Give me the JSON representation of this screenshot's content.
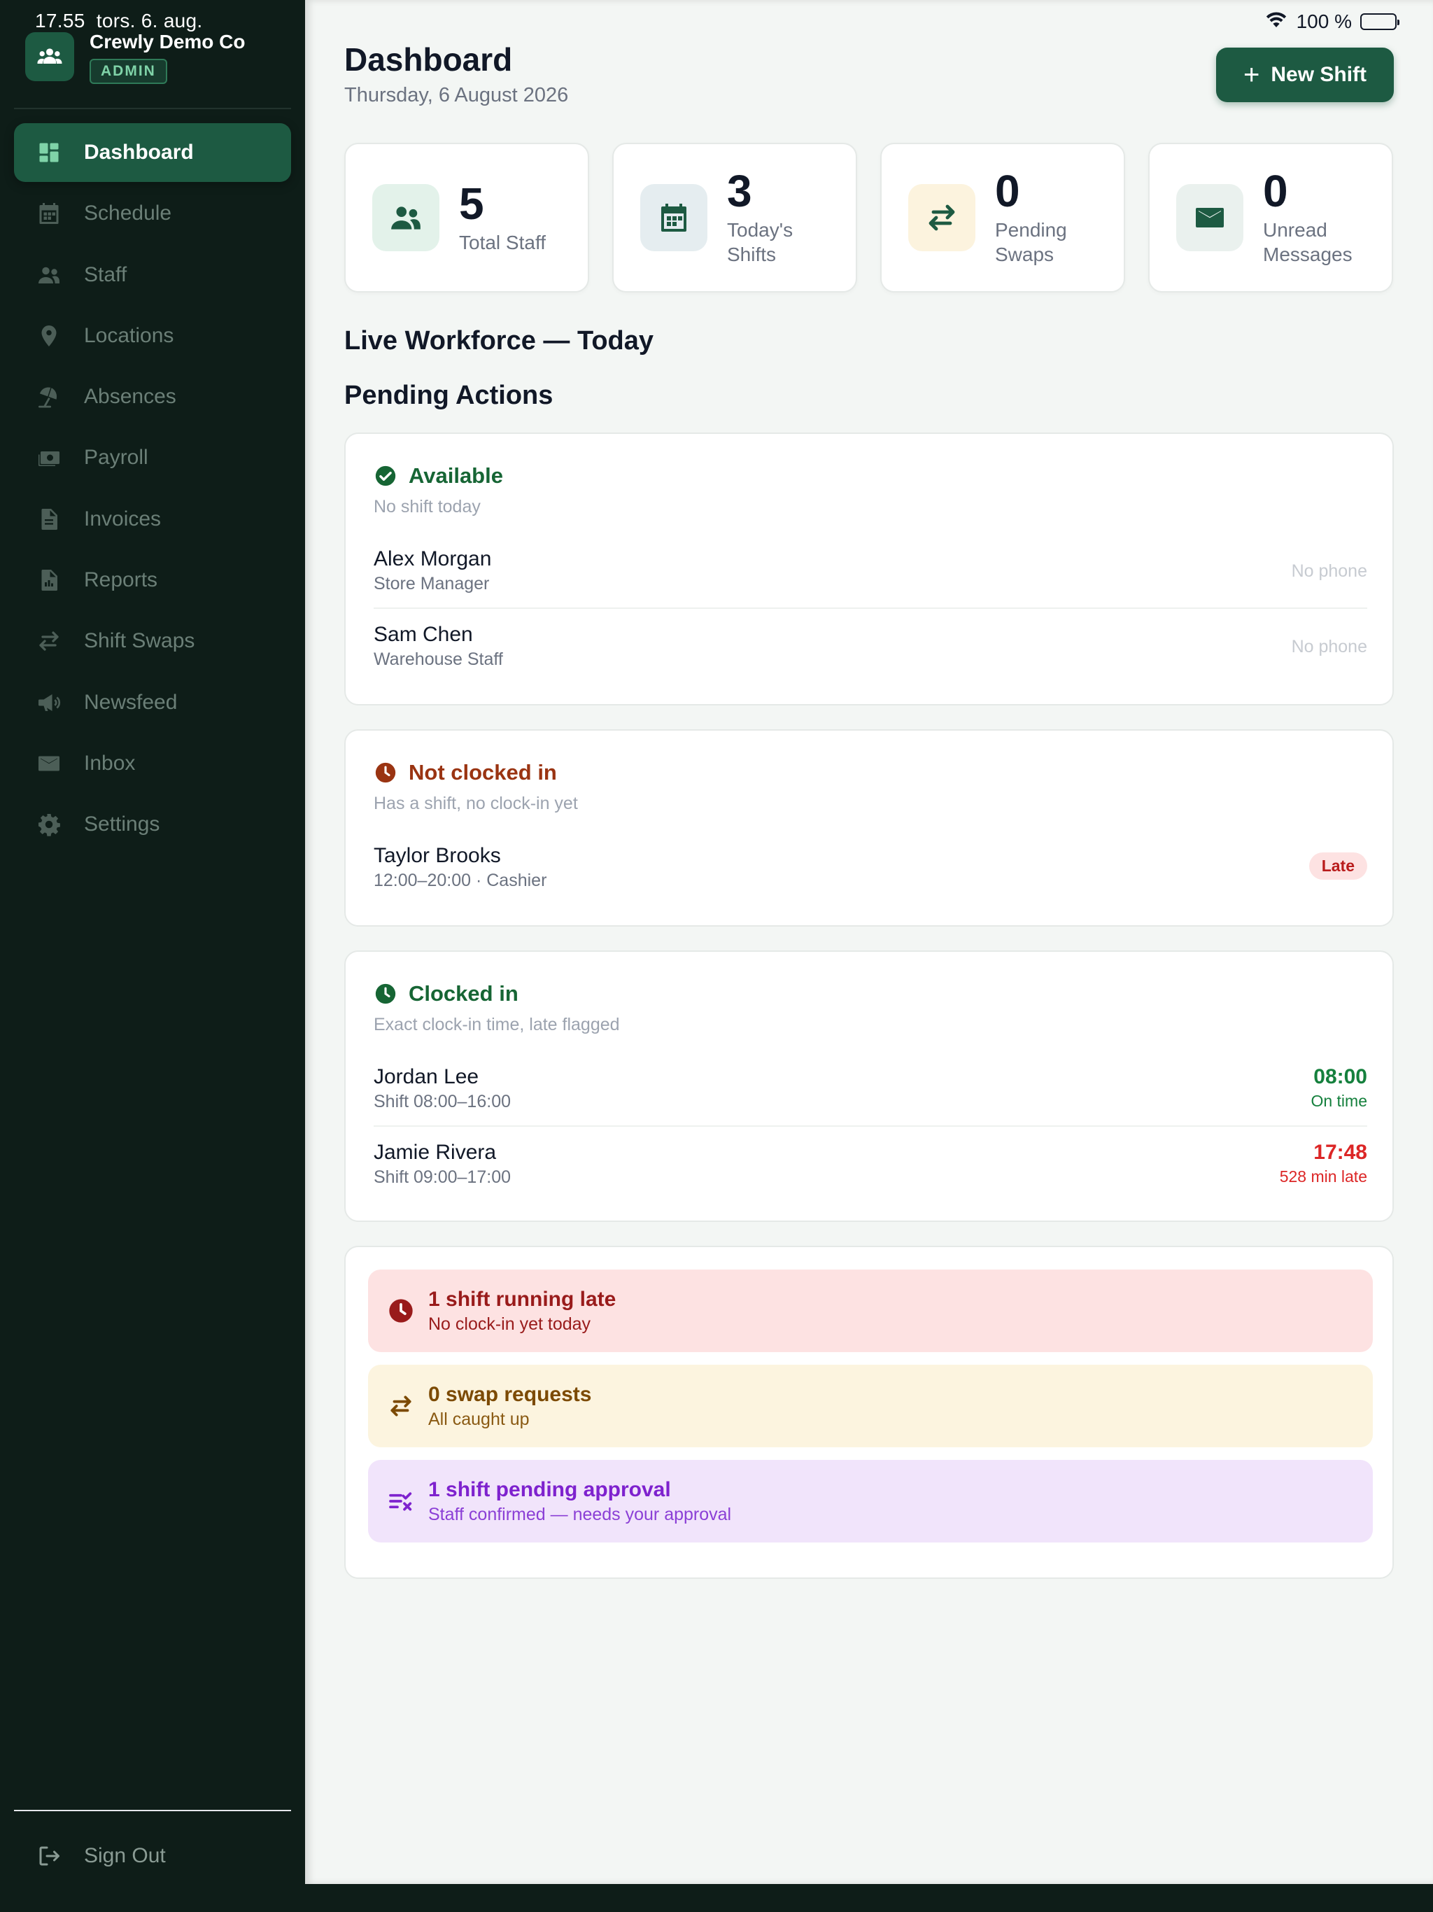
{
  "status_bar": {
    "time": "17.55",
    "date": "tors. 6. aug.",
    "battery": "100 %"
  },
  "brand": {
    "name": "Crewly Demo Co",
    "role": "ADMIN"
  },
  "nav": {
    "items": [
      {
        "label": "Dashboard",
        "icon": "dashboard-icon"
      },
      {
        "label": "Schedule",
        "icon": "calendar-icon"
      },
      {
        "label": "Staff",
        "icon": "people-icon"
      },
      {
        "label": "Locations",
        "icon": "location-pin-icon"
      },
      {
        "label": "Absences",
        "icon": "beach-umbrella-icon"
      },
      {
        "label": "Payroll",
        "icon": "money-icon"
      },
      {
        "label": "Invoices",
        "icon": "document-icon"
      },
      {
        "label": "Reports",
        "icon": "report-icon"
      },
      {
        "label": "Shift Swaps",
        "icon": "swap-icon"
      },
      {
        "label": "Newsfeed",
        "icon": "megaphone-icon"
      },
      {
        "label": "Inbox",
        "icon": "mail-icon"
      },
      {
        "label": "Settings",
        "icon": "gear-icon"
      }
    ],
    "active": "Dashboard",
    "sign_out": "Sign Out"
  },
  "header": {
    "title": "Dashboard",
    "date": "Thursday, 6 August 2026",
    "new_shift": "New Shift"
  },
  "stats": [
    {
      "value": "5",
      "label": "Total Staff",
      "icon": "people-icon"
    },
    {
      "value": "3",
      "label": "Today's Shifts",
      "icon": "calendar-icon"
    },
    {
      "value": "0",
      "label": "Pending Swaps",
      "icon": "swap-icon"
    },
    {
      "value": "0",
      "label": "Unread Messages",
      "icon": "mail-icon"
    }
  ],
  "sections": {
    "live_workforce": "Live Workforce — Today",
    "pending_actions": "Pending Actions"
  },
  "available": {
    "title": "Available",
    "subtitle": "No shift today",
    "rows": [
      {
        "name": "Alex Morgan",
        "role": "Store Manager",
        "phone": "No phone"
      },
      {
        "name": "Sam Chen",
        "role": "Warehouse Staff",
        "phone": "No phone"
      }
    ]
  },
  "not_clocked_in": {
    "title": "Not clocked in",
    "subtitle": "Has a shift, no clock-in yet",
    "rows": [
      {
        "name": "Taylor Brooks",
        "meta": "12:00–20:00 · Cashier",
        "badge": "Late"
      }
    ]
  },
  "clocked_in": {
    "title": "Clocked in",
    "subtitle": "Exact clock-in time, late flagged",
    "rows": [
      {
        "name": "Jordan Lee",
        "shift": "Shift 08:00–16:00",
        "time": "08:00",
        "status": "On time"
      },
      {
        "name": "Jamie Rivera",
        "shift": "Shift 09:00–17:00",
        "time": "17:48",
        "status": "528 min late"
      }
    ]
  },
  "alerts": [
    {
      "title": "1 shift running late",
      "subtitle": "No clock-in yet today",
      "icon": "clock-icon"
    },
    {
      "title": "0 swap requests",
      "subtitle": "All caught up",
      "icon": "swap-icon"
    },
    {
      "title": "1 shift pending approval",
      "subtitle": "Staff confirmed — needs your approval",
      "icon": "checklist-icon"
    }
  ],
  "colors": {
    "sidebar_bg": "#0e1d18",
    "accent": "#1d5a42",
    "available": "#166534",
    "not_clocked_in": "#9a3412",
    "late": "#dc2626",
    "on_time": "#15803d",
    "alert_late_bg": "#fde2e2",
    "alert_swap_bg": "#fcf4df",
    "alert_approval_bg": "#f1e4fb"
  }
}
